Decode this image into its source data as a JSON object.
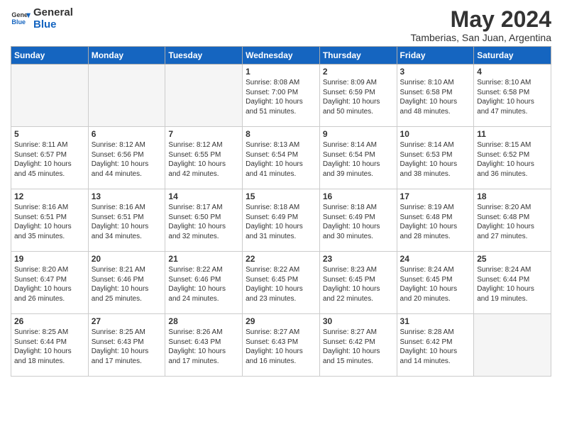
{
  "header": {
    "logo_general": "General",
    "logo_blue": "Blue",
    "month_title": "May 2024",
    "location": "Tamberias, San Juan, Argentina"
  },
  "days_of_week": [
    "Sunday",
    "Monday",
    "Tuesday",
    "Wednesday",
    "Thursday",
    "Friday",
    "Saturday"
  ],
  "weeks": [
    [
      {
        "day": "",
        "info": ""
      },
      {
        "day": "",
        "info": ""
      },
      {
        "day": "",
        "info": ""
      },
      {
        "day": "1",
        "info": "Sunrise: 8:08 AM\nSunset: 7:00 PM\nDaylight: 10 hours\nand 51 minutes."
      },
      {
        "day": "2",
        "info": "Sunrise: 8:09 AM\nSunset: 6:59 PM\nDaylight: 10 hours\nand 50 minutes."
      },
      {
        "day": "3",
        "info": "Sunrise: 8:10 AM\nSunset: 6:58 PM\nDaylight: 10 hours\nand 48 minutes."
      },
      {
        "day": "4",
        "info": "Sunrise: 8:10 AM\nSunset: 6:58 PM\nDaylight: 10 hours\nand 47 minutes."
      }
    ],
    [
      {
        "day": "5",
        "info": "Sunrise: 8:11 AM\nSunset: 6:57 PM\nDaylight: 10 hours\nand 45 minutes."
      },
      {
        "day": "6",
        "info": "Sunrise: 8:12 AM\nSunset: 6:56 PM\nDaylight: 10 hours\nand 44 minutes."
      },
      {
        "day": "7",
        "info": "Sunrise: 8:12 AM\nSunset: 6:55 PM\nDaylight: 10 hours\nand 42 minutes."
      },
      {
        "day": "8",
        "info": "Sunrise: 8:13 AM\nSunset: 6:54 PM\nDaylight: 10 hours\nand 41 minutes."
      },
      {
        "day": "9",
        "info": "Sunrise: 8:14 AM\nSunset: 6:54 PM\nDaylight: 10 hours\nand 39 minutes."
      },
      {
        "day": "10",
        "info": "Sunrise: 8:14 AM\nSunset: 6:53 PM\nDaylight: 10 hours\nand 38 minutes."
      },
      {
        "day": "11",
        "info": "Sunrise: 8:15 AM\nSunset: 6:52 PM\nDaylight: 10 hours\nand 36 minutes."
      }
    ],
    [
      {
        "day": "12",
        "info": "Sunrise: 8:16 AM\nSunset: 6:51 PM\nDaylight: 10 hours\nand 35 minutes."
      },
      {
        "day": "13",
        "info": "Sunrise: 8:16 AM\nSunset: 6:51 PM\nDaylight: 10 hours\nand 34 minutes."
      },
      {
        "day": "14",
        "info": "Sunrise: 8:17 AM\nSunset: 6:50 PM\nDaylight: 10 hours\nand 32 minutes."
      },
      {
        "day": "15",
        "info": "Sunrise: 8:18 AM\nSunset: 6:49 PM\nDaylight: 10 hours\nand 31 minutes."
      },
      {
        "day": "16",
        "info": "Sunrise: 8:18 AM\nSunset: 6:49 PM\nDaylight: 10 hours\nand 30 minutes."
      },
      {
        "day": "17",
        "info": "Sunrise: 8:19 AM\nSunset: 6:48 PM\nDaylight: 10 hours\nand 28 minutes."
      },
      {
        "day": "18",
        "info": "Sunrise: 8:20 AM\nSunset: 6:48 PM\nDaylight: 10 hours\nand 27 minutes."
      }
    ],
    [
      {
        "day": "19",
        "info": "Sunrise: 8:20 AM\nSunset: 6:47 PM\nDaylight: 10 hours\nand 26 minutes."
      },
      {
        "day": "20",
        "info": "Sunrise: 8:21 AM\nSunset: 6:46 PM\nDaylight: 10 hours\nand 25 minutes."
      },
      {
        "day": "21",
        "info": "Sunrise: 8:22 AM\nSunset: 6:46 PM\nDaylight: 10 hours\nand 24 minutes."
      },
      {
        "day": "22",
        "info": "Sunrise: 8:22 AM\nSunset: 6:45 PM\nDaylight: 10 hours\nand 23 minutes."
      },
      {
        "day": "23",
        "info": "Sunrise: 8:23 AM\nSunset: 6:45 PM\nDaylight: 10 hours\nand 22 minutes."
      },
      {
        "day": "24",
        "info": "Sunrise: 8:24 AM\nSunset: 6:45 PM\nDaylight: 10 hours\nand 20 minutes."
      },
      {
        "day": "25",
        "info": "Sunrise: 8:24 AM\nSunset: 6:44 PM\nDaylight: 10 hours\nand 19 minutes."
      }
    ],
    [
      {
        "day": "26",
        "info": "Sunrise: 8:25 AM\nSunset: 6:44 PM\nDaylight: 10 hours\nand 18 minutes."
      },
      {
        "day": "27",
        "info": "Sunrise: 8:25 AM\nSunset: 6:43 PM\nDaylight: 10 hours\nand 17 minutes."
      },
      {
        "day": "28",
        "info": "Sunrise: 8:26 AM\nSunset: 6:43 PM\nDaylight: 10 hours\nand 17 minutes."
      },
      {
        "day": "29",
        "info": "Sunrise: 8:27 AM\nSunset: 6:43 PM\nDaylight: 10 hours\nand 16 minutes."
      },
      {
        "day": "30",
        "info": "Sunrise: 8:27 AM\nSunset: 6:42 PM\nDaylight: 10 hours\nand 15 minutes."
      },
      {
        "day": "31",
        "info": "Sunrise: 8:28 AM\nSunset: 6:42 PM\nDaylight: 10 hours\nand 14 minutes."
      },
      {
        "day": "",
        "info": ""
      }
    ]
  ]
}
